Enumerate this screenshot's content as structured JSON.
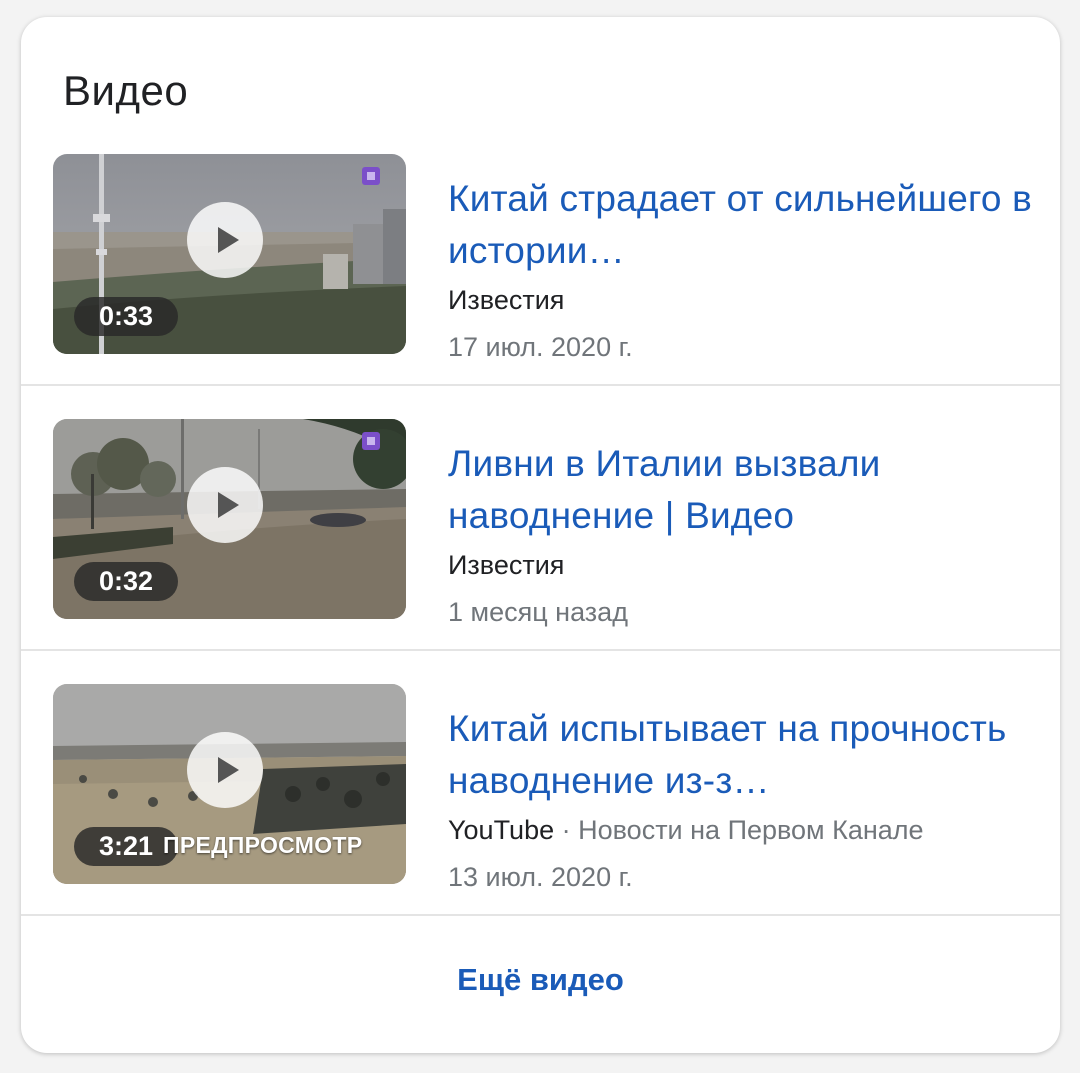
{
  "section_title": "Видео",
  "videos": [
    {
      "title": "Китай страдает от сильнейшего в истории…",
      "source": "Известия",
      "channel": "",
      "date": "17 июл. 2020 г.",
      "duration": "0:33",
      "preview_label": "",
      "thumbnail_icons": [
        "play-icon",
        "badge-icon"
      ]
    },
    {
      "title": "Ливни в Италии вызвали наводнение | Видео",
      "source": "Известия",
      "channel": "",
      "date": "1 месяц назад",
      "duration": "0:32",
      "preview_label": "",
      "thumbnail_icons": [
        "play-icon",
        "badge-icon"
      ]
    },
    {
      "title": "Китай испытывает на прочность наводнение из-з…",
      "source": "YouTube",
      "channel": "· Новости на Первом Канале",
      "date": "13 июл. 2020 г.",
      "duration": "3:21",
      "preview_label": "ПРЕДПРОСМОТР",
      "thumbnail_icons": [
        "play-icon"
      ]
    }
  ],
  "more_link": "Ещё видео",
  "colors": {
    "link": "#1a5bb8",
    "text": "#202124",
    "secondary": "#70757a",
    "badge": "#7b4fc9"
  }
}
